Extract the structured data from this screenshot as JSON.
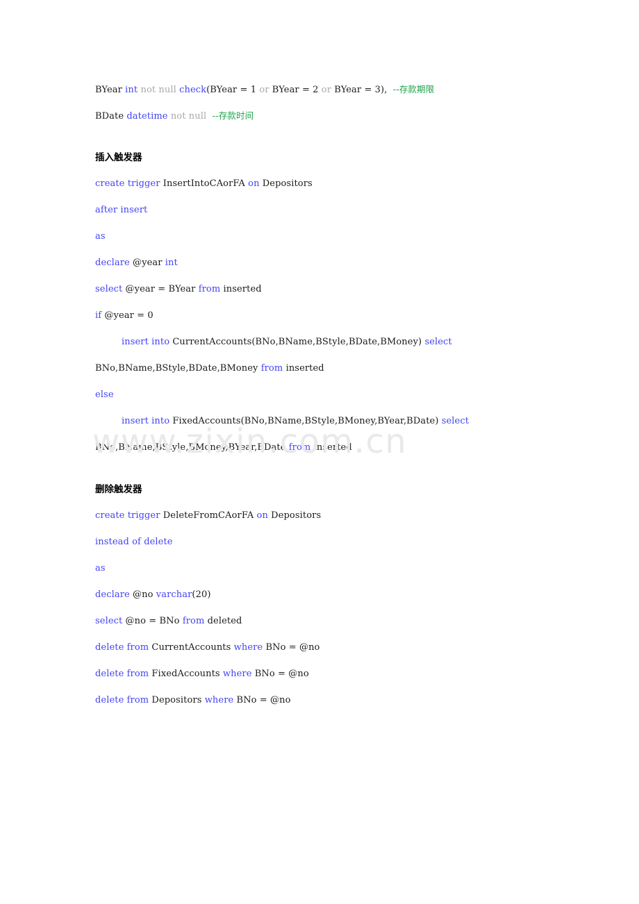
{
  "document": {
    "watermark": "www.zixin.com.cn",
    "colors": {
      "keyword": "#4242f5",
      "dim_keyword": "#a8a8a8",
      "comment": "#1fa34a",
      "text": "#1a1a1a",
      "watermark": "#e9e9e9",
      "background": "#ffffff"
    },
    "headings": {
      "insert_trigger": "插入触发器",
      "delete_trigger": "删除触发器"
    },
    "lines": {
      "byear_col": {
        "t1": "BYear ",
        "k1": "int",
        "d1": " not null ",
        "k2": "check",
        "t2": "(BYear = 1 ",
        "d2": "or",
        "t3": " BYear = 2 ",
        "d3": "or",
        "t4": " BYear = 3),",
        "c1": "  --存款期限"
      },
      "bdate_col": {
        "t1": "BDate ",
        "k1": "datetime",
        "d1": " not null ",
        "c1": " --存款时间"
      },
      "create_insert_trigger": {
        "k1": "create trigger",
        "t1": " InsertIntoCAorFA ",
        "k2": "on",
        "t2": " Depositors"
      },
      "after_insert": {
        "k1": "after insert"
      },
      "as_1": {
        "k1": "as"
      },
      "declare_year": {
        "k1": "declare",
        "t1": " @year ",
        "k2": "int"
      },
      "select_year": {
        "k1": "select",
        "t1": " @year = BYear ",
        "k2": "from",
        "t2": " inserted"
      },
      "if_year": {
        "k1": "if",
        "t1": " @year = 0"
      },
      "insert_current": {
        "k1": "insert into",
        "t1": " CurrentAccounts(BNo,BName,BStyle,BDate,BMoney) ",
        "k2": "select"
      },
      "insert_current_cont": {
        "t1": "BNo,BName,BStyle,BDate,BMoney ",
        "k1": "from",
        "t2": " inserted"
      },
      "else_1": {
        "k1": "else"
      },
      "insert_fixed": {
        "k1": "insert into",
        "t1": " FixedAccounts(BNo,BName,BStyle,BMoney,BYear,BDate) ",
        "k2": "select"
      },
      "insert_fixed_cont": {
        "t1": "BNo,BName,BStyle,BMoney,BYear,BDate ",
        "k1": "from",
        "t2": " inserted"
      },
      "create_delete_trigger": {
        "k1": "create trigger",
        "t1": " DeleteFromCAorFA ",
        "k2": "on",
        "t2": " Depositors"
      },
      "instead_of_delete": {
        "k1": "instead of delete"
      },
      "as_2": {
        "k1": "as"
      },
      "declare_no": {
        "k1": "declare",
        "t1": " @no ",
        "k2": "varchar",
        "t2": "(20)"
      },
      "select_no": {
        "k1": "select",
        "t1": " @no = BNo ",
        "k2": "from",
        "t2": " deleted"
      },
      "delete_current": {
        "k1": "delete from",
        "t1": " CurrentAccounts ",
        "k2": "where",
        "t2": " BNo = @no"
      },
      "delete_fixed": {
        "k1": "delete from",
        "t1": " FixedAccounts ",
        "k2": "where",
        "t2": " BNo = @no"
      },
      "delete_depositors": {
        "k1": "delete from",
        "t1": " Depositors ",
        "k2": "where",
        "t2": " BNo = @no"
      }
    }
  }
}
